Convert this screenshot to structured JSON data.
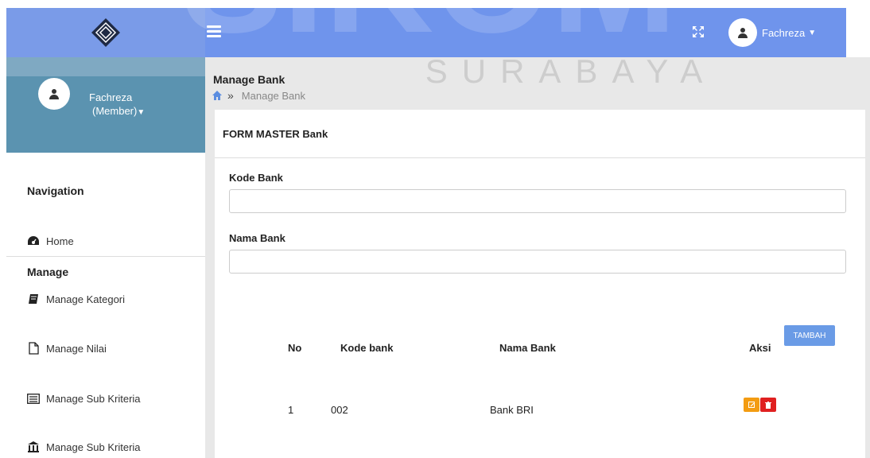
{
  "watermark": {
    "big": "SIKOM",
    "sub": "SURABAYA"
  },
  "topbar": {
    "logo_icon": "diamond-logo",
    "menu_icon": "hamburger-icon",
    "expand_icon": "fullscreen-icon",
    "user_name": "Fachreza",
    "accent": "#6f94ec"
  },
  "sidebar": {
    "profile_name": "Fachreza",
    "profile_role": "(Member)",
    "nav_title": "Navigation",
    "home_label": "Home",
    "manage_title": "Manage",
    "items": [
      {
        "label": "Manage Kategori",
        "icon": "book-icon"
      },
      {
        "label": "Manage Nilai",
        "icon": "file-icon"
      },
      {
        "label": "Manage Sub Kriteria",
        "icon": "list-icon"
      },
      {
        "label": "Manage Sub Kriteria",
        "icon": "bank-icon"
      }
    ]
  },
  "main": {
    "page_title": "Manage Bank",
    "breadcrumb": "Manage Bank",
    "form_title": "FORM MASTER Bank",
    "kode_label": "Kode Bank",
    "kode_value": "",
    "nama_label": "Nama Bank",
    "nama_value": "",
    "add_button": "TAMBAH"
  },
  "table": {
    "headers": [
      "No",
      "Kode bank",
      "Nama Bank",
      "Aksi"
    ],
    "rows": [
      {
        "no": "1",
        "kode": "002",
        "nama": "Bank BRI"
      }
    ],
    "edit_color": "#f39c12",
    "delete_color": "#e02020"
  }
}
